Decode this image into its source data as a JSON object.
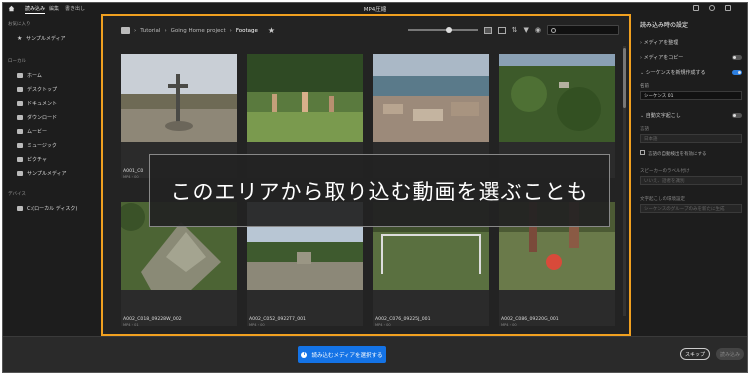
{
  "topbar": {
    "tabs": [
      "読み込み",
      "編集",
      "書き出し"
    ],
    "title": "MP4圧縮"
  },
  "sidebar": {
    "favorites_header": "お気に入り",
    "favorites": [
      "サンプルメディア"
    ],
    "local_header": "ローカル",
    "local": [
      "ホーム",
      "デスクトップ",
      "ドキュメント",
      "ダウンロード",
      "ムービー",
      "ミュージック",
      "ピクチャ",
      "サンプルメディア"
    ],
    "devices_header": "デバイス",
    "devices": [
      "C:(ローカル ディスク)"
    ]
  },
  "breadcrumb": {
    "items": [
      "Tutorial",
      "Going Home project",
      "Footage"
    ],
    "separator": "›"
  },
  "search": {
    "placeholder": ""
  },
  "media": [
    {
      "name": "A001_C0",
      "meta": "MP4・00"
    },
    {
      "name": "",
      "meta": ""
    },
    {
      "name": "",
      "meta": ""
    },
    {
      "name": "",
      "meta": ""
    },
    {
      "name": "A002_C018_09228W_002",
      "meta": "MP4・01"
    },
    {
      "name": "A002_C052_0922T7_001",
      "meta": "MP4・00"
    },
    {
      "name": "A002_C076_09225J_001",
      "meta": "MP4・00"
    },
    {
      "name": "A002_C086_09220G_001",
      "meta": "MP4・00"
    }
  ],
  "overlay_text": "このエリアから取り込む動画を選ぶことも",
  "right_panel": {
    "title": "読み込み時の設定",
    "organize": "メディアを整理",
    "copy": "メディアをコピー",
    "new_sequence": "シーケンスを新規作成する",
    "name_label": "名前",
    "name_value": "シーケンス 01",
    "auto_caption": "自動文字起こし",
    "language_label": "言語",
    "language_value": "日本語",
    "language_detect": "言語の自動検出を有効にする",
    "speaker_label": "スピーカーのラベル付け",
    "speaker_value": "いいえ、話者を識別",
    "preset_label": "文字起こしの環境設定",
    "preset_value": "シーケンスのグループのみを新たに生成"
  },
  "bottom": {
    "select_button": "読み込むメディアを選択する",
    "skip": "スキップ",
    "import": "読み込み"
  },
  "colors": {
    "accent": "#1473e6",
    "highlight_border": "#f0a020"
  }
}
